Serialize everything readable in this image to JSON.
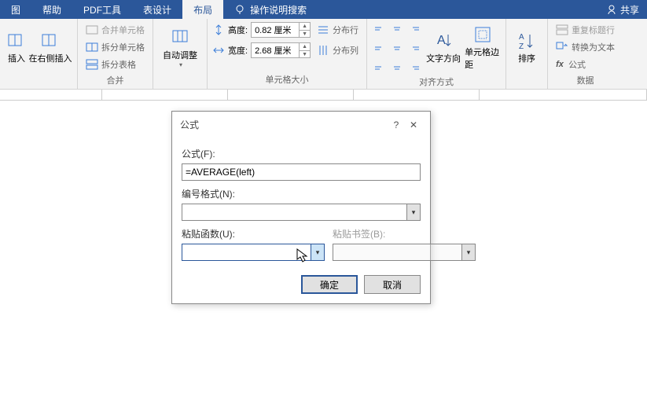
{
  "tabs": {
    "t0": "图",
    "t1": "帮助",
    "t2": "PDF工具",
    "t3": "表设计",
    "t4": "布局",
    "search": "操作说明搜索",
    "share": "共享"
  },
  "ribbon": {
    "insert": {
      "left": "插入",
      "right": "在右侧插入",
      "group": " "
    },
    "merge": {
      "merge": "合并单元格",
      "split": "拆分单元格",
      "splitTable": "拆分表格",
      "group": "合并"
    },
    "autofit": {
      "label": "自动调整",
      "group": " "
    },
    "cellsize": {
      "heightLabel": "高度:",
      "height": "0.82 厘米",
      "widthLabel": "宽度:",
      "width": "2.68 厘米",
      "distRows": "分布行",
      "distCols": "分布列",
      "group": "单元格大小"
    },
    "align": {
      "textdir": "文字方向",
      "margins": "单元格边距",
      "group": "对齐方式"
    },
    "sort": {
      "sort": "排序",
      "group": " "
    },
    "data": {
      "repeat": "重复标题行",
      "toText": "转换为文本",
      "formula": "公式",
      "group": "数据"
    }
  },
  "dialog": {
    "title": "公式",
    "formulaLabel": "公式(F):",
    "formulaValue": "=AVERAGE(left)",
    "numFormatLabel": "编号格式(N):",
    "pasteFuncLabel": "粘贴函数(U):",
    "pasteBookmarkLabel": "粘贴书签(B):",
    "ok": "确定",
    "cancel": "取消"
  }
}
